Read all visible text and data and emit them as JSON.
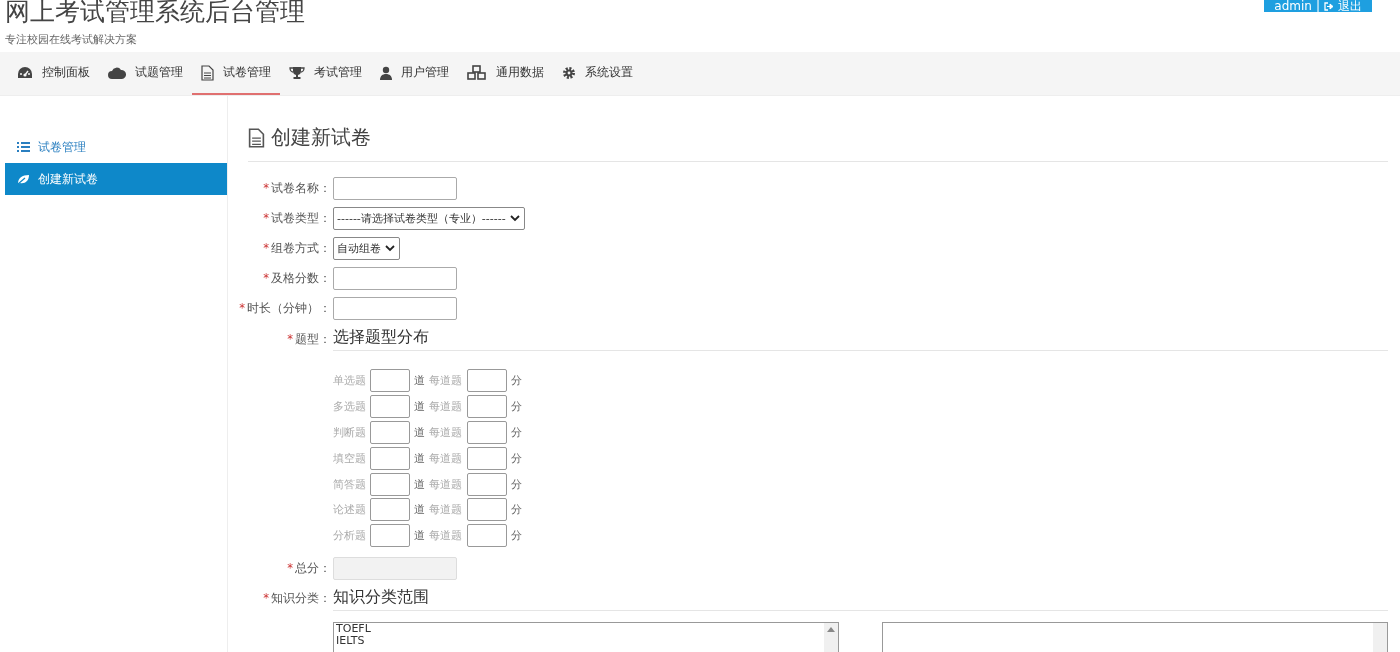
{
  "header": {
    "title": "网上考试管理系统后台管理",
    "subtitle": "专注校园在线考试解决方案",
    "user": {
      "name": "admin",
      "separator": "|",
      "logout": "退出"
    }
  },
  "nav": [
    {
      "label": "控制面板",
      "selected": false
    },
    {
      "label": "试题管理",
      "selected": false
    },
    {
      "label": "试卷管理",
      "selected": true
    },
    {
      "label": "考试管理",
      "selected": false
    },
    {
      "label": "用户管理",
      "selected": false
    },
    {
      "label": "通用数据",
      "selected": false
    },
    {
      "label": "系统设置",
      "selected": false
    }
  ],
  "sidebar": {
    "items": [
      {
        "label": "试卷管理",
        "selected": false
      },
      {
        "label": "创建新试卷",
        "selected": true
      }
    ]
  },
  "page_title": "创建新试卷",
  "form": {
    "fields": [
      {
        "kind": "text",
        "required_mark": "*",
        "label": "试卷名称："
      },
      {
        "kind": "select",
        "required_mark": "*",
        "label": "试卷类型：",
        "value": "------请选择试卷类型（专业）------"
      },
      {
        "kind": "select",
        "required_mark": "*",
        "label": "组卷方式：",
        "value": "自动组卷"
      },
      {
        "kind": "text",
        "required_mark": "*",
        "label": "及格分数："
      },
      {
        "kind": "text",
        "required_mark": "*",
        "label": "时长（分钟）："
      }
    ],
    "types": {
      "required_mark": "*",
      "label": "题型：",
      "heading": "选择题型分布",
      "rows": [
        {
          "label": "单选题",
          "count_unit": "道",
          "per_label": "每道题",
          "score_unit": "分"
        },
        {
          "label": "多选题",
          "count_unit": "道",
          "per_label": "每道题",
          "score_unit": "分"
        },
        {
          "label": "判断题",
          "count_unit": "道",
          "per_label": "每道题",
          "score_unit": "分"
        },
        {
          "label": "填空题",
          "count_unit": "道",
          "per_label": "每道题",
          "score_unit": "分"
        },
        {
          "label": "简答题",
          "count_unit": "道",
          "per_label": "每道题",
          "score_unit": "分"
        },
        {
          "label": "论述题",
          "count_unit": "道",
          "per_label": "每道题",
          "score_unit": "分"
        },
        {
          "label": "分析题",
          "count_unit": "道",
          "per_label": "每道题",
          "score_unit": "分"
        }
      ]
    },
    "total": {
      "required_mark": "*",
      "label": "总分：",
      "disabled": true
    },
    "knowledge": {
      "required_mark": "*",
      "label": "知识分类：",
      "heading": "知识分类范围",
      "options": [
        "TOEFL",
        "IELTS"
      ]
    }
  }
}
